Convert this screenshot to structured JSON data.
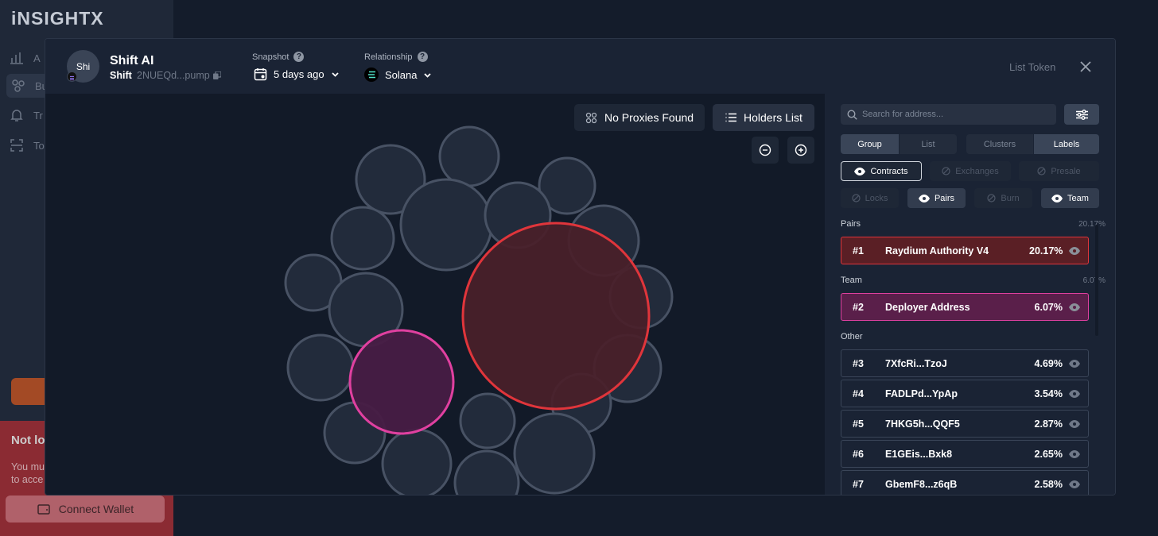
{
  "background": {
    "logo": "iNSIGHTX",
    "nav": [
      {
        "icon": "bar-chart-icon",
        "label": "A"
      },
      {
        "icon": "bubbles-icon",
        "label": "Bu"
      },
      {
        "icon": "bell-icon",
        "label": "Tr"
      },
      {
        "icon": "scan-icon",
        "label": "To"
      }
    ],
    "login_title": "Not lo",
    "login_text_1": "You mu",
    "login_text_2": "to acce",
    "connect_label": "Connect Wallet"
  },
  "header": {
    "avatar_text": "Shi",
    "token_name": "Shift AI",
    "token_symbol": "Shift",
    "token_address": "2NUEQd...pump",
    "snapshot_label": "Snapshot",
    "snapshot_value": "5 days ago",
    "relationship_label": "Relationship",
    "relationship_value": "Solana",
    "list_token": "List Token"
  },
  "canvas": {
    "no_proxies": "No Proxies Found",
    "holders_list": "Holders List"
  },
  "panel": {
    "search_placeholder": "Search for address...",
    "tabs": [
      "Group",
      "List",
      "Clusters",
      "Labels"
    ],
    "filters": {
      "contracts": "Contracts",
      "exchanges": "Exchanges",
      "presale": "Presale",
      "locks": "Locks",
      "pairs": "Pairs",
      "burn": "Burn",
      "team": "Team"
    },
    "sections": {
      "pairs": {
        "title": "Pairs",
        "pct": "20.17%"
      },
      "team": {
        "title": "Team",
        "pct": "6.07%"
      },
      "other": {
        "title": "Other"
      }
    },
    "holders": [
      {
        "rank": "#1",
        "name": "Raydium Authority V4",
        "pct": "20.17%"
      },
      {
        "rank": "#2",
        "name": "Deployer Address",
        "pct": "6.07%"
      },
      {
        "rank": "#3",
        "name": "7XfcRi...TzoJ",
        "pct": "4.69%"
      },
      {
        "rank": "#4",
        "name": "FADLPd...YpAp",
        "pct": "3.54%"
      },
      {
        "rank": "#5",
        "name": "7HKG5h...QQF5",
        "pct": "2.87%"
      },
      {
        "rank": "#6",
        "name": "E1GEis...Bxk8",
        "pct": "2.65%"
      },
      {
        "rank": "#7",
        "name": "GbemF8...z6qB",
        "pct": "2.58%"
      }
    ]
  },
  "colors": {
    "pair_stroke": "#e0353b",
    "team_stroke": "#e040a0",
    "bubble_stroke": "#485264"
  }
}
